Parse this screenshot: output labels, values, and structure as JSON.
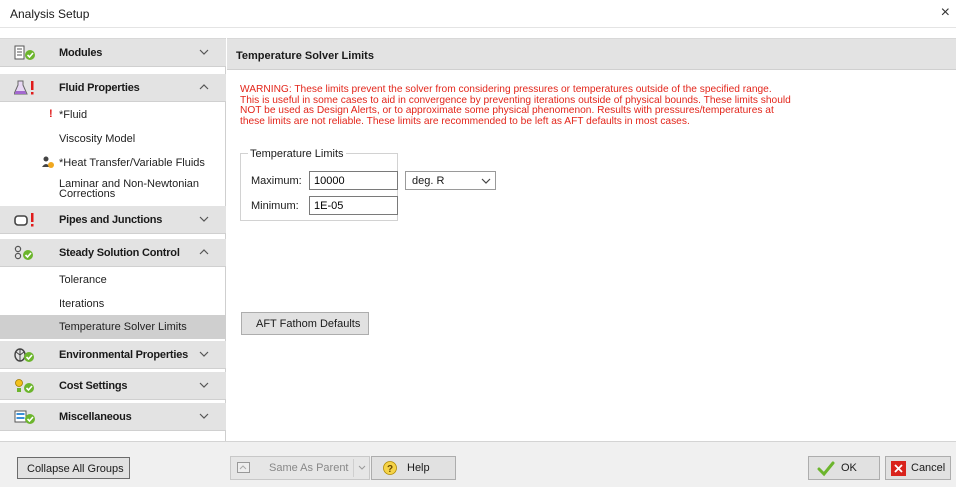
{
  "window": {
    "title": "Analysis Setup",
    "close_glyph": "×"
  },
  "sidebar": {
    "groups": [
      {
        "label": "Modules",
        "icon": "modules-icon",
        "expanded": false,
        "warning": false
      },
      {
        "label": "Fluid Properties",
        "icon": "flask-icon",
        "expanded": true,
        "warning": true,
        "items": [
          {
            "label": "*Fluid",
            "warning": true
          },
          {
            "label": "Viscosity Model"
          },
          {
            "label": "*Heat Transfer/Variable Fluids",
            "warning": true
          },
          {
            "label": "Laminar and Non-Newtonian",
            "label2": "Corrections"
          }
        ]
      },
      {
        "label": "Pipes and Junctions",
        "icon": "pipe-icon",
        "expanded": false,
        "warning": true
      },
      {
        "label": "Steady Solution Control",
        "icon": "solution-control-icon",
        "expanded": true,
        "warning": false,
        "items": [
          {
            "label": "Tolerance"
          },
          {
            "label": "Iterations"
          },
          {
            "label": "Temperature Solver Limits",
            "selected": true
          }
        ]
      },
      {
        "label": "Environmental Properties",
        "icon": "environment-icon",
        "expanded": false,
        "warning": false
      },
      {
        "label": "Cost Settings",
        "icon": "cost-icon",
        "expanded": false,
        "warning": false
      },
      {
        "label": "Miscellaneous",
        "icon": "miscellaneous-icon",
        "expanded": false,
        "warning": false
      }
    ]
  },
  "panel": {
    "title": "Temperature Solver Limits",
    "warning_lines": [
      "WARNING: These limits prevent the solver from considering pressures or temperatures outside of the specified range.",
      "This is useful in some cases to aid in convergence by preventing iterations outside of physical bounds. These limits should",
      "NOT be used as Design Alerts, or to approximate some physical phenomenon. Results with pressures/temperatures at",
      "these limits are not reliable. These limits are recommended to be left as AFT defaults in most cases."
    ],
    "limits": {
      "group_label": "Temperature Limits",
      "maximum_label": "Maximum:",
      "maximum_value": "10000",
      "minimum_label": "Minimum:",
      "minimum_value": "1E-05",
      "unit": "deg. R"
    },
    "defaults_button": "AFT Fathom Defaults"
  },
  "footer": {
    "collapse_button": "Collapse All Groups",
    "same_as_parent": "Same As Parent",
    "help": "Help",
    "ok": "OK",
    "cancel": "Cancel"
  },
  "colors": {
    "warning_text": "#e3261b",
    "group_header_bg": "#e3e3e3",
    "ok_check": "#6cb52d",
    "cancel_x": "#d9231c"
  }
}
